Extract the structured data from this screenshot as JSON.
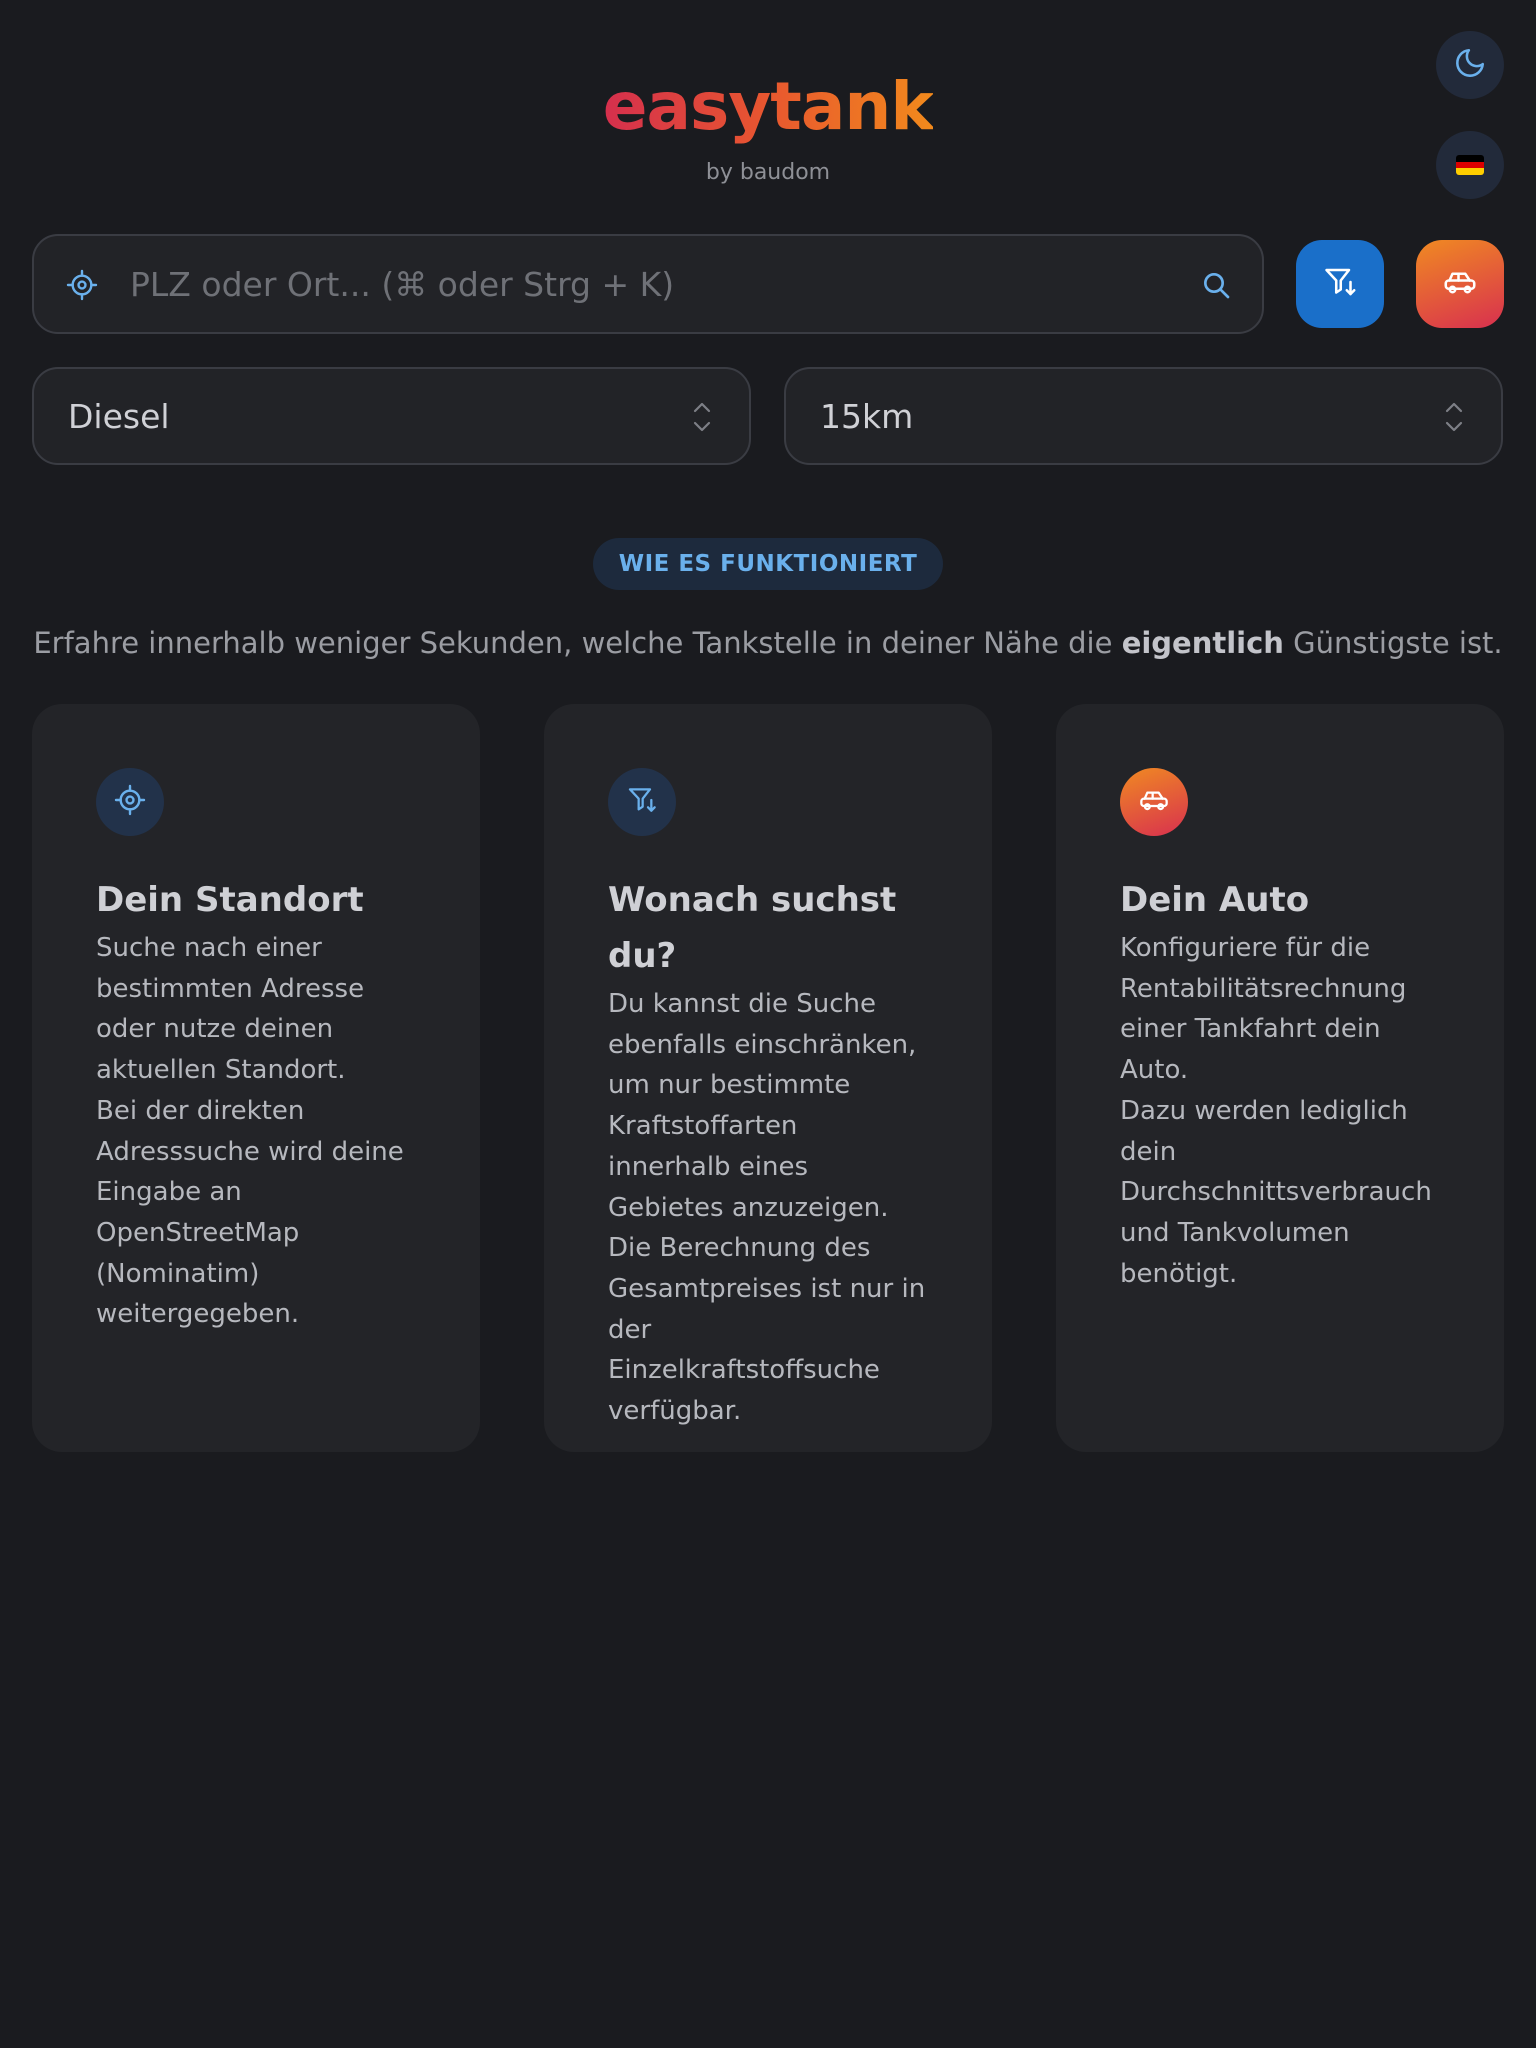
{
  "header": {
    "logo": "easytank",
    "byline": "by baudom"
  },
  "top_controls": {
    "theme_icon": "moon-icon",
    "language_flag": "germany-flag",
    "flag_colors": [
      "#000000",
      "#dd0000",
      "#ffce00"
    ]
  },
  "search": {
    "placeholder": "PLZ oder Ort... (⌘ oder Strg + K)",
    "value": "",
    "location_icon": "crosshair-icon",
    "search_icon": "search-icon"
  },
  "action_buttons": {
    "filter_icon": "filter-icon",
    "car_icon": "car-icon"
  },
  "filters": {
    "fuel": "Diesel",
    "radius": "15km"
  },
  "info": {
    "badge": "WIE ES FUNKTIONIERT",
    "tagline_before": "Erfahre innerhalb weniger Sekunden, welche Tankstelle in deiner Nähe die ",
    "tagline_bold": "eigentlich",
    "tagline_after": " Günstigste ist."
  },
  "cards": [
    {
      "icon": "crosshair-icon",
      "title": "Dein Standort",
      "text_1": "Suche nach einer bestimmten Adresse oder nutze deinen aktuellen Standort.",
      "text_2": "Bei der direkten Adresssuche wird deine Eingabe an OpenStreetMap (Nominatim) weitergegeben."
    },
    {
      "icon": "filter-icon",
      "title": "Wonach suchst du?",
      "text_1": "Du kannst die Suche ebenfalls einschränken, um nur bestimmte Kraftstoffarten innerhalb eines Gebietes anzuzeigen.",
      "text_2": "Die Berechnung des Gesamtpreises ist nur in der Einzelkraftstoffsuche verfügbar."
    },
    {
      "icon": "car-icon",
      "title": "Dein Auto",
      "text_1": "Konfiguriere für die Rentabilitätsrechnung einer Tankfahrt dein Auto.",
      "text_2": "Dazu werden lediglich dein Durchschnittsverbrauch und Tankvolumen benötigt."
    }
  ],
  "colors": {
    "background": "#1a1b1f",
    "card": "#232428",
    "accent_blue": "#1a6fc9",
    "badge_text": "#6ab0ec",
    "gradient_start": "#d52f4d",
    "gradient_end": "#f28a1c"
  }
}
